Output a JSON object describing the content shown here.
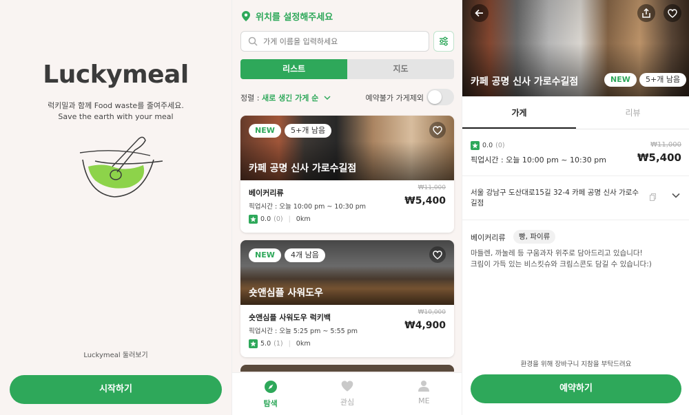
{
  "colors": {
    "accent": "#2ea85a",
    "background": "#f9f4f2"
  },
  "splash": {
    "logo": "Luckymeal",
    "tagline_ko": "럭키밀과 함께 Food waste를 줄여주세요.",
    "tagline_en": "Save the earth with your meal",
    "browse_link": "Luckymeal 둘러보기",
    "start_button": "시작하기"
  },
  "explore": {
    "location_label": "위치를 설정해주세요",
    "search_placeholder": "가게 이름을 입력하세요",
    "tabs": {
      "list": "리스트",
      "map": "지도"
    },
    "sort_prefix": "정렬 : ",
    "sort_value": "새로 생긴 가게 순",
    "reserve_filter_label": "예약불가 가게제외",
    "cards": [
      {
        "badge": "NEW",
        "remaining": "5+개 남음",
        "store_name": "카페 공명 신사 가로수길점",
        "category": "베이커리류",
        "pickup_time": "픽업시간 : 오늘 10:00 pm ~ 10:30 pm",
        "rating": "0.0",
        "reviews": "(0)",
        "distance": "0km",
        "original_price": "₩11,000",
        "price": "₩5,400"
      },
      {
        "badge": "NEW",
        "remaining": "4개 남음",
        "store_name": "숏앤심플 사워도우",
        "category": "숏앤심플 사워도우 럭키백",
        "pickup_time": "픽업시간 : 오늘 5:25 pm ~ 5:55 pm",
        "rating": "5.0",
        "reviews": "(1)",
        "distance": "0km",
        "original_price": "₩10,000",
        "price": "₩4,900"
      }
    ],
    "tabbar": [
      {
        "label": "탐색",
        "icon": "compass-icon"
      },
      {
        "label": "관심",
        "icon": "heart-icon"
      },
      {
        "label": "ME",
        "icon": "person-icon"
      }
    ]
  },
  "detail": {
    "store_name": "카페 공명 신사 가로수길점",
    "badge": "NEW",
    "remaining": "5+개 남음",
    "tabs": {
      "store": "가게",
      "review": "리뷰"
    },
    "rating": "0.0",
    "reviews": "(0)",
    "pickup_time": "픽업시간 : 오늘 10:00 pm ~ 10:30 pm",
    "original_price": "₩11,000",
    "price": "₩5,400",
    "address": "서울 강남구 도산대로15길 32-4 카페 공명 신사 가로수길점",
    "category": "베이커리류",
    "tag": "빵, 파이류",
    "description_line1": "마들렌, 까눌레 등 구움과자 위주로 담아드리고 있습니다!",
    "description_line2": "크림이 가득 있는 비스킷슈와 크림스콘도 담길 수 있습니다:)",
    "eco_note": "환경을 위해 장바구니 지참을 부탁드려요",
    "reserve_button": "예약하기"
  }
}
